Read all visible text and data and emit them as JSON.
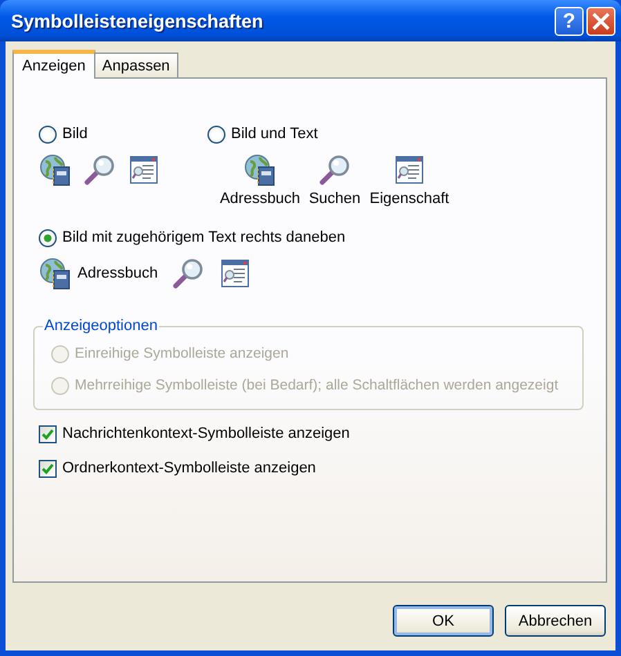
{
  "window": {
    "title": "Symbolleisteneigenschaften",
    "help": "?"
  },
  "tabs": [
    {
      "label": "Anzeigen",
      "selected": true
    },
    {
      "label": "Anpassen",
      "selected": false
    }
  ],
  "display_modes": [
    {
      "kind": "icons",
      "label": "Bild",
      "selected": false
    },
    {
      "kind": "text_below",
      "label": "Bild und Text",
      "selected": false,
      "labels": [
        "Adressbuch",
        "Suchen",
        "Eigenschaft"
      ]
    },
    {
      "kind": "text_right",
      "label": "Bild mit zugehörigem Text rechts daneben",
      "selected": true,
      "labels": [
        "Adressbuch"
      ]
    }
  ],
  "display_options": {
    "title": "Anzeigeoptionen",
    "disabled": true,
    "options": [
      {
        "label": "Einreihige Symbolleiste anzeigen",
        "selected": false
      },
      {
        "label": "Mehrreihige Symbolleiste (bei Bedarf); alle Schaltflächen werden angezeigt",
        "selected": false
      }
    ]
  },
  "checkboxes": [
    {
      "label": "Nachrichtenkontext-Symbolleiste anzeigen",
      "checked": true
    },
    {
      "label": "Ordnerkontext-Symbolleiste anzeigen",
      "checked": true
    }
  ],
  "buttons": [
    {
      "label": "OK",
      "default": true
    },
    {
      "label": "Abbrechen",
      "default": false
    }
  ]
}
